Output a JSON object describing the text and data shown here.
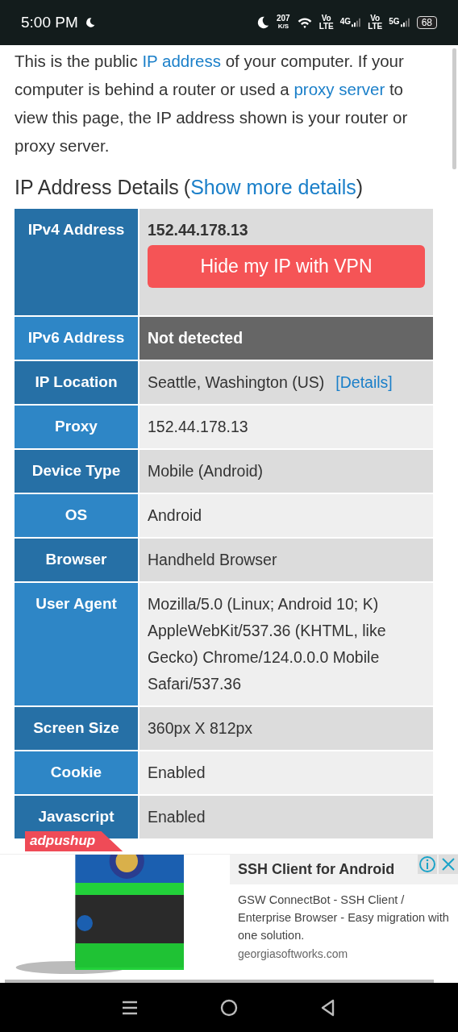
{
  "status_bar": {
    "time": "5:00 PM",
    "speed": {
      "value": "207",
      "unit": "K/S"
    },
    "sims": [
      {
        "top": "Vo",
        "bottom": "LTE",
        "network": "4G"
      },
      {
        "top": "Vo",
        "bottom": "LTE",
        "network": "5G"
      }
    ],
    "battery": "68"
  },
  "intro": [
    {
      "text": "This is the public ",
      "link": false
    },
    {
      "text": "IP address",
      "link": true
    },
    {
      "text": " of your computer. If your computer is behind a router or used a ",
      "link": false
    },
    {
      "text": "proxy server",
      "link": true
    },
    {
      "text": " to view this page, the IP address shown is your router or proxy server.",
      "link": false
    }
  ],
  "heading": {
    "title": "IP Address Details",
    "open": "(",
    "link": "Show more details",
    "close": ")"
  },
  "rows": [
    {
      "label": "IPv4 Address",
      "kind": "primary",
      "value": "152.44.178.13",
      "button": "Hide my IP with VPN"
    },
    {
      "label": "IPv6 Address",
      "kind": "alert",
      "value": "Not detected"
    },
    {
      "label": "IP Location",
      "kind": "link",
      "value": "Seattle, Washington (US)",
      "link": "[Details]"
    },
    {
      "label": "Proxy",
      "kind": "plain",
      "value": "152.44.178.13"
    },
    {
      "label": "Device Type",
      "kind": "plain",
      "value": "Mobile (Android)"
    },
    {
      "label": "OS",
      "kind": "plain",
      "value": "Android"
    },
    {
      "label": "Browser",
      "kind": "plain",
      "value": "Handheld Browser"
    },
    {
      "label": "User Agent",
      "kind": "plain",
      "value": "Mozilla/5.0 (Linux; Android 10; K) AppleWebKit/537.36 (KHTML, like Gecko) Chrome/124.0.0.0 Mobile Safari/537.36"
    },
    {
      "label": "Screen Size",
      "kind": "plain",
      "value": "360px X 812px"
    },
    {
      "label": "Cookie",
      "kind": "plain",
      "value": "Enabled"
    },
    {
      "label": "Javascript",
      "kind": "plain",
      "value": "Enabled"
    }
  ],
  "ad": {
    "badge": "adpushup",
    "title": "SSH Client for Android",
    "description": "GSW ConnectBot - SSH Client / Enterprise Browser - Easy migration with one solution.",
    "domain": "georgiasoftworks.com"
  }
}
